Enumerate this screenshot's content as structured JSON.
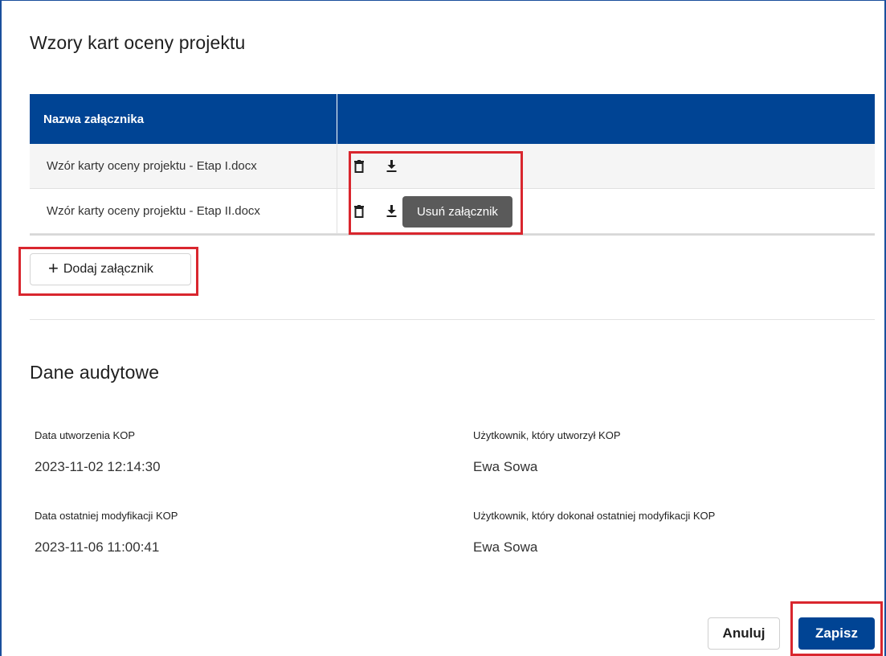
{
  "section_attachments": {
    "title": "Wzory kart oceny projektu",
    "table": {
      "header": {
        "name_col": "Nazwa załącznika",
        "actions_col": ""
      },
      "rows": [
        {
          "name": "Wzór karty oceny projektu - Etap I.docx"
        },
        {
          "name": "Wzór karty oceny projektu - Etap II.docx"
        }
      ]
    },
    "tooltip": "Usuń załącznik",
    "add_button": {
      "icon": "plus-icon",
      "label": "Dodaj załącznik"
    }
  },
  "section_audit": {
    "title": "Dane audytowe",
    "fields": {
      "created_date_label": "Data utworzenia KOP",
      "created_date_value": "2023-11-02 12:14:30",
      "created_user_label": "Użytkownik, który utworzył KOP",
      "created_user_value": "Ewa Sowa",
      "modified_date_label": "Data ostatniej modyfikacji KOP",
      "modified_date_value": "2023-11-06 11:00:41",
      "modified_user_label": "Użytkownik, który dokonał ostatniej modyfikacji KOP",
      "modified_user_value": "Ewa Sowa"
    }
  },
  "footer": {
    "cancel_label": "Anuluj",
    "save_label": "Zapisz"
  },
  "colors": {
    "header_blue": "#004494",
    "highlight_red": "#d9262e",
    "tooltip_gray": "#5a5a5a"
  },
  "icons": {
    "delete": "trash-icon",
    "download": "download-icon"
  }
}
